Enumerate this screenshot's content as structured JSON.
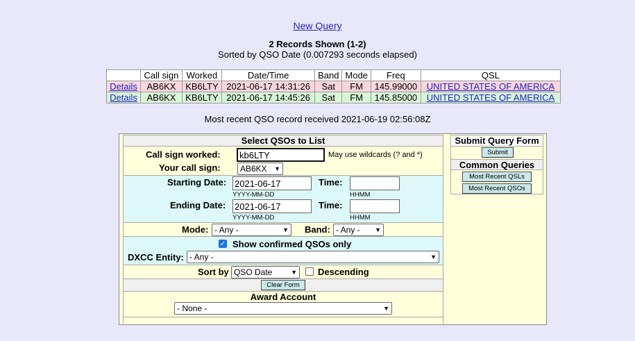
{
  "header": {
    "new_query": "New Query",
    "records_shown": "2 Records Shown (1-2)",
    "sorted_by": "Sorted by QSO Date (0.007293 seconds elapsed)"
  },
  "table": {
    "columns": [
      "",
      "Call sign",
      "Worked",
      "Date/Time",
      "Band",
      "Mode",
      "Freq",
      "QSL"
    ],
    "rows": [
      {
        "link": "Details",
        "call": "AB6KX",
        "worked": "KB6LTY",
        "datetime": "2021-06-17 14:31:26",
        "band": "Sat",
        "mode": "FM",
        "freq": "145.99000",
        "qsl": "UNITED STATES OF AMERICA"
      },
      {
        "link": "Details",
        "call": "AB6KX",
        "worked": "KB6LTY",
        "datetime": "2021-06-17 14:45:26",
        "band": "Sat",
        "mode": "FM",
        "freq": "145.85000",
        "qsl": "UNITED STATES OF AMERICA"
      }
    ]
  },
  "recent": "Most recent QSO record received 2021-06-19 02:56:08Z",
  "form": {
    "title": "Select QSOs to List",
    "call_worked_label": "Call sign worked:",
    "call_worked_value": "kb6LTY",
    "wildcard_hint": "May use wildcards (? and *)",
    "your_call_label": "Your call sign:",
    "your_call_value": "AB6KX",
    "start_date_label": "Starting Date:",
    "start_date_value": "2021-06-17",
    "end_date_label": "Ending Date:",
    "end_date_value": "2021-06-17",
    "time_label": "Time:",
    "date_format": "YYYY-MM-DD",
    "time_format": "HHMM",
    "mode_label": "Mode:",
    "mode_value": "- Any -",
    "band_label": "Band:",
    "band_value": "- Any -",
    "confirmed_label": "Show confirmed QSOs only",
    "dxcc_label": "DXCC Entity:",
    "dxcc_value": "- Any -",
    "sort_label": "Sort by",
    "sort_value": "QSO Date",
    "descending_label": "Descending",
    "clear_button": "Clear Form",
    "award_title": "Award Account",
    "award_value": "- None -"
  },
  "side": {
    "submit_title": "Submit Query Form",
    "submit_button": "Submit",
    "common_title": "Common Queries",
    "qsls_button": "Most Recent QSLs",
    "qsos_button": "Most Recent QSOs"
  },
  "colors": {
    "pink_row": "#f8d6dc",
    "green_row": "#d8f5d8",
    "button": "#c9e8e8",
    "link": "#2222cc"
  }
}
